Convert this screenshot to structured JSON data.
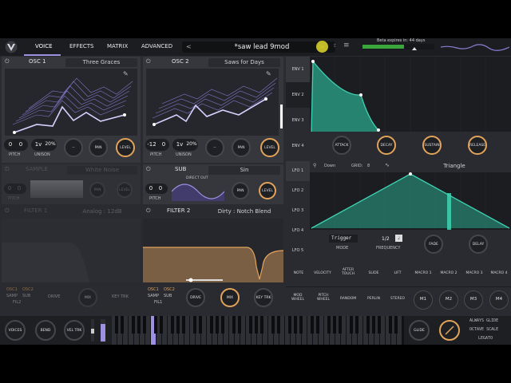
{
  "header": {
    "tabs": [
      {
        "label": "VOICE"
      },
      {
        "label": "EFFECTS"
      },
      {
        "label": "MATRIX"
      },
      {
        "label": "ADVANCED"
      }
    ],
    "preset_name": "*saw lead 9mod",
    "beta_text": "Beta expires in: 44 days",
    "arrow_left": "<",
    "arrow_right": ">"
  },
  "osc1": {
    "title": "OSC 1",
    "wave": "Three Graces",
    "pitch_oct": "0",
    "pitch_semi": "0",
    "unison_voices": "1v",
    "unison_detune": "20%",
    "pitch_label": "PITCH",
    "unison_label": "UNISON",
    "pan": "PAN",
    "level": "LEVEL",
    "dash": "--"
  },
  "osc2": {
    "title": "OSC 2",
    "wave": "Saws for Days",
    "pitch_oct": "-12",
    "pitch_semi": "0",
    "unison_voices": "1v",
    "unison_detune": "20%",
    "pitch_label": "PITCH",
    "unison_label": "UNISON",
    "pan": "PAN",
    "level": "LEVEL",
    "dash": "--"
  },
  "sample": {
    "title": "SAMPLE",
    "name": "White Noise",
    "pitch_oct": "0",
    "pitch_semi": "0",
    "pitch_label": "PITCH",
    "pan": "PAN",
    "level": "LEVEL"
  },
  "sub": {
    "title": "SUB",
    "wave": "Sin",
    "direct_out": "DIRECT OUT",
    "pitch_oct": "0",
    "pitch_semi": "0",
    "pitch_label": "PITCH",
    "pan": "PAN",
    "level": "LEVEL"
  },
  "filter1": {
    "title": "FILTER 1",
    "model": "Analog : 12dB",
    "routes_top": [
      "OSC1",
      "OSC2"
    ],
    "routes_bottom": [
      "SAMP",
      "SUB"
    ],
    "fil_label": "FIL2",
    "drive": "DRIVE",
    "mix": "MIX",
    "key_trk": "KEY TRK"
  },
  "filter2": {
    "title": "FILTER 2",
    "model": "Dirty : Notch Blend",
    "routes_top": [
      "OSC1",
      "OSC2"
    ],
    "routes_bottom": [
      "SAMP",
      "SUB"
    ],
    "fil_label": "FIL1",
    "drive": "DRIVE",
    "mix": "MIX",
    "key_trk": "KEY TRK"
  },
  "envelopes": {
    "tabs": [
      "ENV 1",
      "ENV 2",
      "ENV 3",
      "ENV 4"
    ],
    "knobs": [
      "ATTACK",
      "DECAY",
      "SUSTAIN",
      "RELEASE"
    ]
  },
  "lfos": {
    "tabs": [
      "LFO 1",
      "LFO 2",
      "LFO 3",
      "LFO 4",
      "LFO 5"
    ],
    "sync_label": "Down",
    "grid_label": "GRID:",
    "grid_value": "8",
    "shape": "Triangle",
    "mode_value": "Trigger",
    "mode_label": "MODE",
    "freq_value": "1/2",
    "freq_label": "FREQUENCY",
    "fade": "FADE",
    "delay": "DELAY"
  },
  "mod_sources": {
    "row1": [
      "NOTE",
      "VELOCITY",
      "AFTER TOUCH",
      "SLIDE",
      "LIFT",
      "MACRO 1",
      "MACRO 2",
      "MACRO 3",
      "MACRO 4"
    ],
    "row2": [
      "MOD WHEEL",
      "PITCH WHEEL",
      "RANDOM",
      "PERLIN",
      "STEREO"
    ],
    "macros": [
      "M1",
      "M2",
      "M3",
      "M4"
    ]
  },
  "bottom": {
    "voices": "VOICES",
    "bend": "BEND",
    "vel_trk": "VEL TRK",
    "glide": "GLIDE",
    "always_glide": "ALWAYS GLIDE",
    "octave_scale": "OCTAVE SCALE",
    "legato": "LEGATO"
  },
  "colors": {
    "accent_purple": "#9e8fe0",
    "accent_orange": "#e2a35a",
    "accent_teal": "#3fd3b4"
  }
}
